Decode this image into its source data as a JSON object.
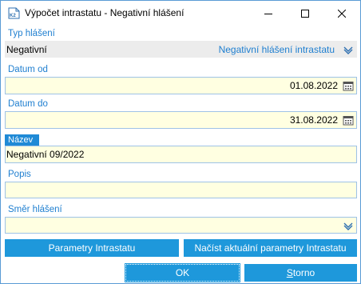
{
  "window": {
    "title": "Výpočet intrastatu - Negativní hlášení",
    "icon": "k2-app-icon",
    "controls": [
      "minimize-icon",
      "maximize-icon",
      "close-icon"
    ]
  },
  "form": {
    "typ_hlaseni": {
      "label": "Typ hlášení",
      "value": "Negativní",
      "description": "Negativní hlášení intrastatu"
    },
    "datum_od": {
      "label": "Datum od",
      "value": "01.08.2022"
    },
    "datum_do": {
      "label": "Datum do",
      "value": "31.08.2022"
    },
    "nazev": {
      "label": "Název",
      "value": "Negativní 09/2022"
    },
    "popis": {
      "label": "Popis",
      "value": ""
    },
    "smer_hlaseni": {
      "label": "Směr hlášení",
      "value": ""
    }
  },
  "buttons": {
    "parametry": "Parametry Intrastatu",
    "nacist": "Načíst aktuální parametry Intrastatu",
    "ok": "OK",
    "storno_first": "S",
    "storno_rest": "torno"
  },
  "colors": {
    "accent": "#1e98db",
    "label": "#1f7fd0",
    "field_bg": "#ffffe1",
    "field_border": "#9ec2e6"
  }
}
